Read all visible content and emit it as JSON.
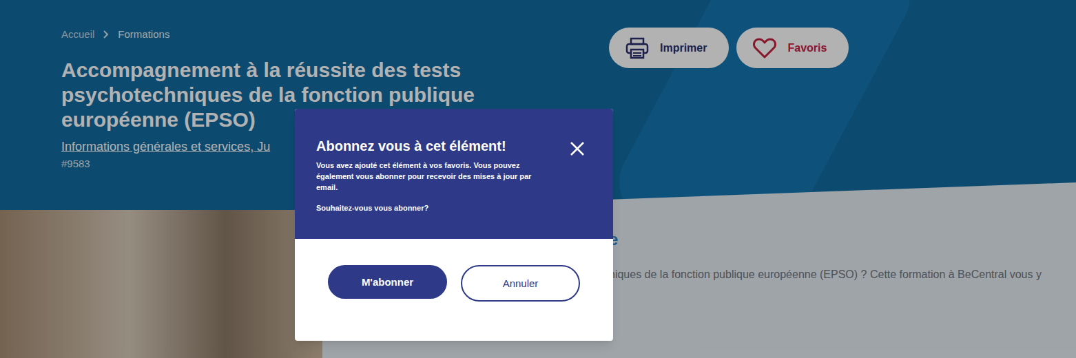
{
  "breadcrumb": [
    {
      "label": "Accueil"
    },
    {
      "label": "Formations"
    }
  ],
  "title": "Accompagnement à la réussite des tests psychotechniques de la fonction publique européenne (EPSO)",
  "categories": "Informations générales et services, Ju",
  "reference": "#9583",
  "actions": [
    {
      "label": "Imprimer",
      "kind": "print"
    },
    {
      "label": "Favoris",
      "kind": "favorite"
    }
  ],
  "content": {
    "heading": "e",
    "intro": "niques de la fonction publique européenne (EPSO) ? Cette formation à BeCentral vous y"
  },
  "dialog": {
    "title": "Abonnez vous à cet élément!",
    "message": "Vous avez ajouté cet élément à vos favoris. Vous pouvez également vous abonner pour recevoir des mises à jour par email.",
    "question": "Souhaitez-vous vous abonner?",
    "buttons": [
      {
        "label": "M'abonner",
        "kind": "primary"
      },
      {
        "label": "Annuler",
        "kind": "secondary"
      }
    ]
  }
}
